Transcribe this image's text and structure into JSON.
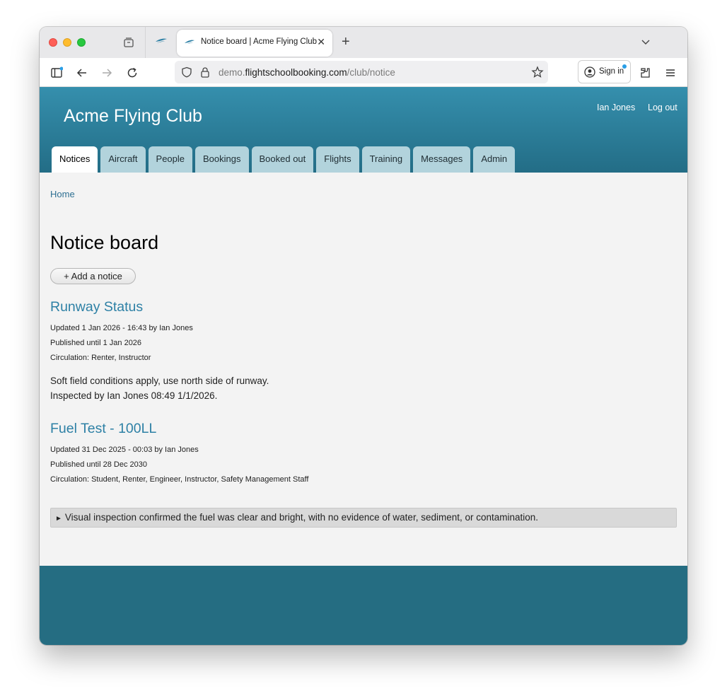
{
  "browser": {
    "tab_title": "Notice board | Acme Flying Club",
    "tab_close": "✕",
    "new_tab": "+",
    "url_prefix": "demo.",
    "url_host": "flightschoolbooking.com",
    "url_path": "/club/notice",
    "sign_in_label": "Sign in"
  },
  "header": {
    "site_title": "Acme Flying Club",
    "user_name": "Ian Jones",
    "logout_label": "Log out"
  },
  "nav_tabs": [
    "Notices",
    "Aircraft",
    "People",
    "Bookings",
    "Booked out",
    "Flights",
    "Training",
    "Messages",
    "Admin"
  ],
  "breadcrumb": "Home",
  "page": {
    "title": "Notice board",
    "add_button": "+ Add a notice"
  },
  "notices": [
    {
      "title": "Runway Status",
      "updated": "Updated 1 Jan 2026 - 16:43 by Ian Jones",
      "published": "Published until 1 Jan 2026",
      "circulation": "Circulation: Renter, Instructor",
      "body_line1": "Soft field conditions apply, use north side of runway.",
      "body_line2": "Inspected by Ian Jones 08:49 1/1/2026."
    },
    {
      "title": "Fuel Test - 100LL",
      "updated": "Updated 31 Dec 2025 - 00:03 by Ian Jones",
      "published": "Published until 28 Dec 2030",
      "circulation": "Circulation: Student, Renter, Engineer, Instructor, Safety Management Staff",
      "details_arrow": "►",
      "details_summary": "Visual inspection confirmed the fuel was clear and bright, with no evidence of water, sediment, or contamination."
    }
  ],
  "colors": {
    "header_top": "#358fad",
    "header_bottom": "#236d86",
    "tab_inactive": "#b2d3dc",
    "link": "#2d80a5",
    "footer": "#256d82"
  }
}
